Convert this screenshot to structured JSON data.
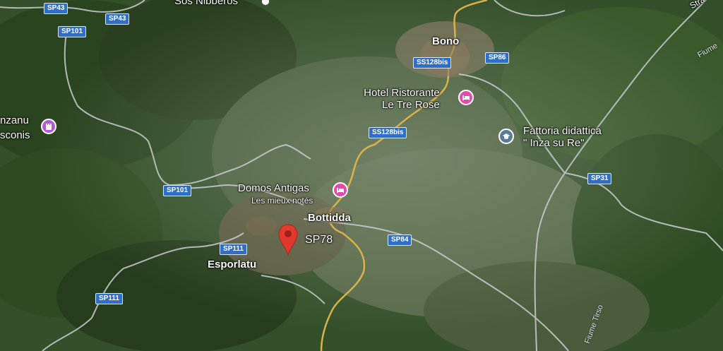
{
  "map": {
    "places": {
      "sos_nibberos": "Sos Nibberos",
      "bono": "Bono",
      "bottidda": "Bottidda",
      "esporlatu": "Esporlatu",
      "sp78": "SP78",
      "anzanu": "nzanu",
      "sconis": "sconis",
      "strada": "Stra",
      "fiume_top": "Fiume",
      "fiume_tirso": "Fiume Tirso"
    },
    "pois": {
      "hotel_tre_rose_line1": "Hotel Ristorante",
      "hotel_tre_rose_line2": "Le Tre Rose",
      "domos_antigas": "Domos Antigas",
      "domos_antigas_sub": "Les mieux notés",
      "fattoria_line1": "Fattoria didattica",
      "fattoria_line2": "\" Inza su Re\""
    },
    "shields": {
      "sp43_a": "SP43",
      "sp43_b": "SP43",
      "sp101_a": "SP101",
      "sp101_b": "SP101",
      "ss128bis_a": "SS128bis",
      "ss128bis_b": "SS128bis",
      "sp86": "SP86",
      "sp31": "SP31",
      "sp84": "SP84",
      "sp111_a": "SP111",
      "sp111_b": "SP111"
    },
    "icons": {
      "hotel": "bed-icon",
      "school": "graduation-cap-icon",
      "castle": "castle-icon",
      "pin": "location-pin-icon"
    },
    "colors": {
      "road_major": "#d9b24a",
      "road_minor": "#c9ced3",
      "shield": "#2f6fc7",
      "pin": "#e03a2f",
      "hotel_marker": "#e64aa8",
      "edu_marker": "#5b7b97",
      "castle_marker": "#b25ad6"
    }
  }
}
